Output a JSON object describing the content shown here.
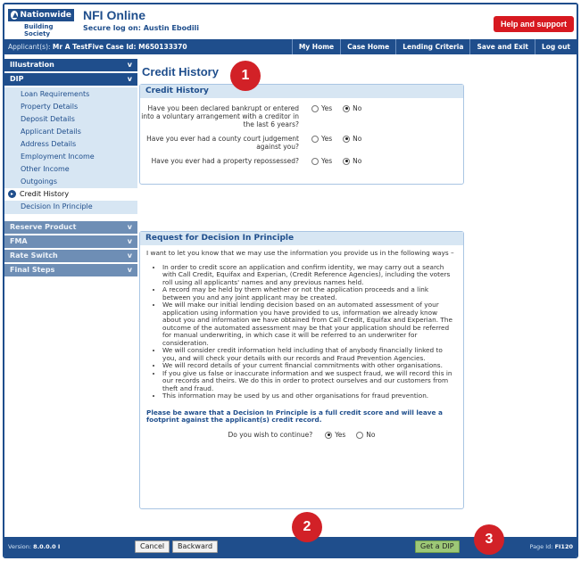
{
  "header": {
    "logo_brand": "Nationwide",
    "logo_sub": "Building Society",
    "app_title": "NFI Online",
    "secure_log": "Secure log on: Austin Ebodili",
    "help_label": "Help and support"
  },
  "topbar": {
    "applicant_prefix": "Applicant(s):",
    "applicant_value": "Mr A TestFive Case Id: M650133370",
    "nav": [
      "My Home",
      "Case Home",
      "Lending Criteria",
      "Save and Exit",
      "Log out"
    ]
  },
  "sidebar": {
    "sections": [
      {
        "label": "Illustration",
        "chevron": "v"
      },
      {
        "label": "DIP",
        "chevron": "v"
      }
    ],
    "dip_items": [
      "Loan Requirements",
      "Property Details",
      "Deposit Details",
      "Applicant Details",
      "Address Details",
      "Employment Income",
      "Other Income",
      "Outgoings",
      "Credit History",
      "Decision In Principle"
    ],
    "active_item": "Credit History",
    "collapsed_sections": [
      "Reserve Product",
      "FMA",
      "Rate Switch",
      "Final Steps"
    ]
  },
  "main": {
    "page_title": "Credit History",
    "credit_panel": {
      "title": "Credit History",
      "questions": [
        {
          "text": "Have you been declared bankrupt or entered into a voluntary arrangement with a creditor in the last 6 years?",
          "yes": "Yes",
          "no": "No",
          "selected": "No"
        },
        {
          "text": "Have you ever had a county court judgement against you?",
          "yes": "Yes",
          "no": "No",
          "selected": "No"
        },
        {
          "text": "Have you ever had a property repossessed?",
          "yes": "Yes",
          "no": "No",
          "selected": "No"
        }
      ]
    },
    "dip_panel": {
      "title": "Request for Decision In Principle",
      "intro": "I want to let you know that we may use the information you provide us in the following ways –",
      "bullets": [
        "In order to credit score an application and confirm identity, we may carry out a search with Call Credit, Equifax and Experian, (Credit Reference Agencies), including the voters roll using all applicants' names and any previous names held.",
        "A record may be held by them whether or not the application proceeds and a link between you and any joint applicant may be created.",
        "We will make our initial lending decision based on an automated assessment of your application using information you have provided to us, information we already know about you and information we have obtained from Call Credit, Equifax and Experian. The outcome of the automated assessment may be that your application should be referred for manual underwriting, in which case it will be referred to an underwriter for consideration.",
        "We will consider credit information held including that of anybody financially linked to you, and will check your details with our records and Fraud Prevention Agencies.",
        "We will record details of your current financial commitments with other organisations.",
        "If you give us false or inaccurate information and we suspect fraud, we will record this in our records and theirs. We do this in order to protect ourselves and our customers from theft and fraud.",
        "This information may be used by us and other organisations for fraud prevention."
      ],
      "warning": "Please be aware that a Decision In Principle is a full credit score and will leave a footprint against the applicant(s) credit record.",
      "continue_question": "Do you wish to continue?",
      "yes": "Yes",
      "no": "No",
      "selected": "Yes"
    }
  },
  "footer": {
    "version_label": "Version:",
    "version_value": "8.0.0.0 I",
    "cancel": "Cancel",
    "backward": "Backward",
    "get_dip": "Get a DIP",
    "page_id_label": "Page Id:",
    "page_id_value": "FI120"
  },
  "callouts": [
    "1",
    "2",
    "3"
  ],
  "colors": {
    "brand_blue": "#1f4e8c",
    "help_red": "#d71920",
    "callout_red": "#d22127",
    "panel_header": "#d7e6f3",
    "dip_button": "#9dc877"
  }
}
